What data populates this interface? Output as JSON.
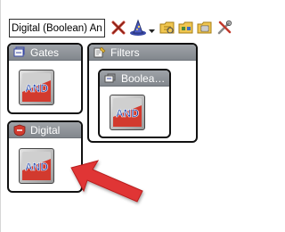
{
  "toolbar": {
    "search_value": "Digital (Boolean) And",
    "buttons": [
      {
        "name": "clear-filter-icon",
        "color": "#c0392b"
      },
      {
        "name": "wizard-hat-icon",
        "color": "#3a4aa8"
      },
      {
        "name": "open-folder-icon",
        "color": "#e0b43a"
      },
      {
        "name": "folder-group-icon",
        "color": "#e0b43a"
      },
      {
        "name": "folder-stack-icon",
        "color": "#e0b43a"
      },
      {
        "name": "tools-icon",
        "color": "#c0392b"
      }
    ]
  },
  "panels": {
    "gates": {
      "title": "Gates",
      "icon": "gates-icon"
    },
    "filters": {
      "title": "Filters",
      "icon": "filters-icon"
    },
    "boolean": {
      "title": "Boolean..."
    },
    "digital": {
      "title": "Digital",
      "icon": "digital-icon"
    }
  },
  "and_tile": {
    "label": "AND",
    "label_color": "#1a3fa8",
    "bg_red": "#d23a2e"
  },
  "annotation": {
    "arrow_color": "#e03535"
  }
}
